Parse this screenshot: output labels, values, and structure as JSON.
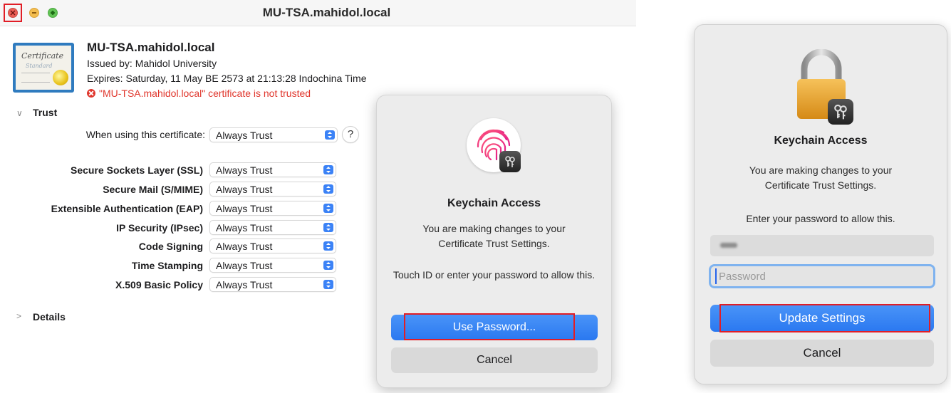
{
  "window": {
    "title": "MU-TSA.mahidol.local"
  },
  "certificate": {
    "name": "MU-TSA.mahidol.local",
    "issued_by": "Issued by: Mahidol University",
    "expires": "Expires: Saturday, 11 May BE 2573 at 21:13:28 Indochina Time",
    "warning": "\"MU-TSA.mahidol.local\" certificate is not trusted",
    "icon_text_1": "Certificate",
    "icon_text_2": "Standard"
  },
  "trust": {
    "section_label": "Trust",
    "when_using_label": "When using this certificate:",
    "when_using_value": "Always Trust",
    "help_label": "?",
    "rows": [
      {
        "label": "Secure Sockets Layer (SSL)",
        "value": "Always Trust"
      },
      {
        "label": "Secure Mail (S/MIME)",
        "value": "Always Trust"
      },
      {
        "label": "Extensible Authentication (EAP)",
        "value": "Always Trust"
      },
      {
        "label": "IP Security (IPsec)",
        "value": "Always Trust"
      },
      {
        "label": "Code Signing",
        "value": "Always Trust"
      },
      {
        "label": "Time Stamping",
        "value": "Always Trust"
      },
      {
        "label": "X.509 Basic Policy",
        "value": "Always Trust"
      }
    ]
  },
  "details": {
    "section_label": "Details"
  },
  "touch_dialog": {
    "title": "Keychain Access",
    "message": "You are making changes to your Certificate Trust Settings.",
    "prompt": "Touch ID or enter your password to allow this.",
    "use_password_label": "Use Password...",
    "cancel_label": "Cancel"
  },
  "password_dialog": {
    "title": "Keychain Access",
    "message": "You are making changes to your Certificate Trust Settings.",
    "prompt": "Enter your password to allow this.",
    "password_placeholder": "Password",
    "update_label": "Update Settings",
    "cancel_label": "Cancel"
  },
  "colors": {
    "accent_blue": "#2a78f0",
    "warning_red": "#e0362c",
    "highlight_red": "#e11d26"
  }
}
